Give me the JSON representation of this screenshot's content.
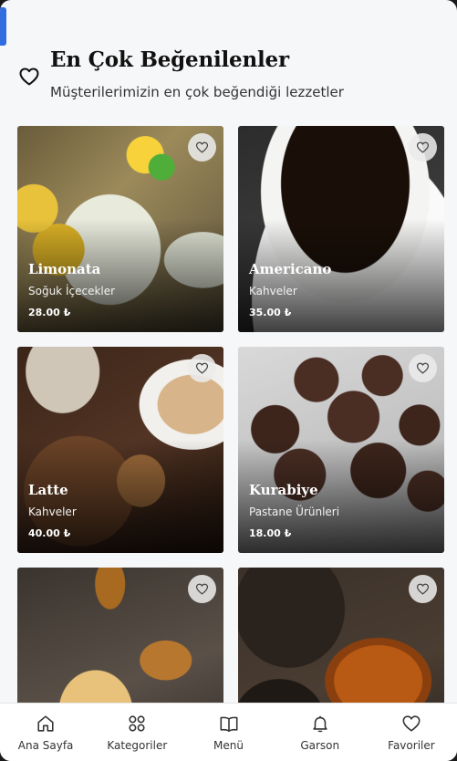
{
  "header": {
    "title": "En Çok Beğenilenler",
    "subtitle": "Müşterilerimizin en çok beğendiği lezzetler"
  },
  "products": [
    {
      "name": "Limonata",
      "category": "Soğuk İçecekler",
      "price": "28.00 ₺"
    },
    {
      "name": "Americano",
      "category": "Kahveler",
      "price": "35.00 ₺"
    },
    {
      "name": "Latte",
      "category": "Kahveler",
      "price": "40.00 ₺"
    },
    {
      "name": "Kurabiye",
      "category": "Pastane Ürünleri",
      "price": "18.00 ₺"
    },
    {
      "name": "",
      "category": "",
      "price": ""
    },
    {
      "name": "",
      "category": "",
      "price": ""
    }
  ],
  "nav": {
    "items": [
      {
        "label": "Ana Sayfa",
        "icon": "home-icon"
      },
      {
        "label": "Kategoriler",
        "icon": "grid-icon"
      },
      {
        "label": "Menü",
        "icon": "book-icon"
      },
      {
        "label": "Garson",
        "icon": "bell-icon"
      },
      {
        "label": "Favoriler",
        "icon": "heart-icon"
      }
    ]
  },
  "colors": {
    "accent": "#2f6de0",
    "background": "#f6f7f9"
  }
}
